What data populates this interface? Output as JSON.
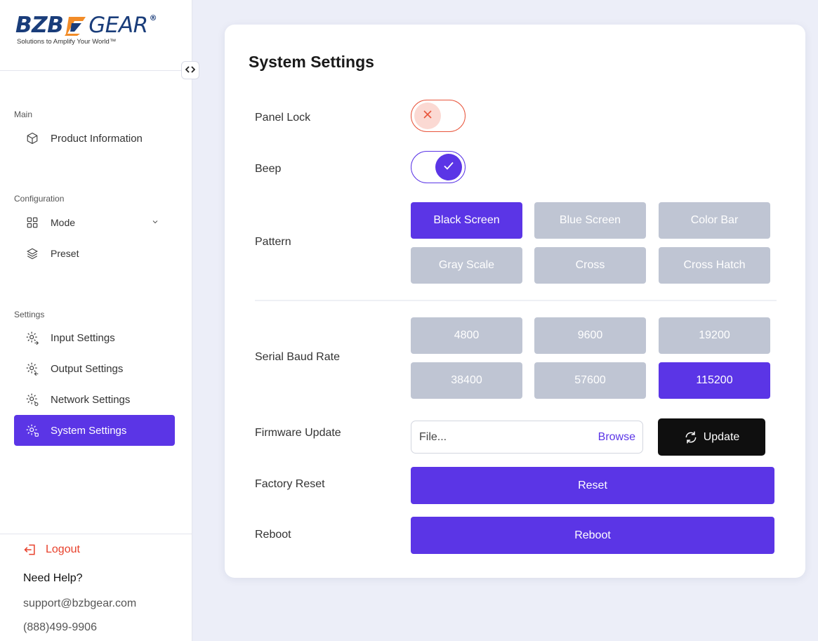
{
  "brand": {
    "name_left": "BZB",
    "name_right": "GEAR",
    "registered": "®",
    "tagline": "Solutions to Amplify Your World™",
    "colors": {
      "navy": "#1a3d7a",
      "orange": "#f28c28"
    }
  },
  "sidebar": {
    "collapse_icon": "chevrons-left-right-icon",
    "sections": {
      "main": "Main",
      "configuration": "Configuration",
      "settings": "Settings"
    },
    "items": [
      {
        "label": "Product Information",
        "icon": "cube-icon"
      },
      {
        "label": "Mode",
        "icon": "grid-icon",
        "expandable": true
      },
      {
        "label": "Preset",
        "icon": "layers-icon"
      },
      {
        "label": "Input Settings",
        "icon": "gear-input-icon"
      },
      {
        "label": "Output Settings",
        "icon": "gear-output-icon"
      },
      {
        "label": "Network Settings",
        "icon": "gear-network-icon"
      },
      {
        "label": "System Settings",
        "icon": "gear-system-icon",
        "active": true
      }
    ],
    "logout": "Logout",
    "help": {
      "title": "Need Help?",
      "email": "support@bzbgear.com",
      "phone": "(888)499-9906"
    }
  },
  "main": {
    "title": "System Settings",
    "panel_lock": {
      "label": "Panel Lock",
      "state": "off"
    },
    "beep": {
      "label": "Beep",
      "state": "on"
    },
    "pattern": {
      "label": "Pattern",
      "options": [
        "Black Screen",
        "Blue Screen",
        "Color Bar",
        "Gray Scale",
        "Cross",
        "Cross Hatch"
      ],
      "selected": "Black Screen"
    },
    "baud_rate": {
      "label": "Serial Baud Rate",
      "options": [
        "4800",
        "9600",
        "19200",
        "38400",
        "57600",
        "115200"
      ],
      "selected": "115200"
    },
    "firmware": {
      "label": "Firmware Update",
      "placeholder": "File...",
      "browse": "Browse",
      "update": "Update"
    },
    "factory_reset": {
      "label": "Factory Reset",
      "button": "Reset"
    },
    "reboot": {
      "label": "Reboot",
      "button": "Reboot"
    }
  },
  "colors": {
    "accent": "#5b35e6",
    "inactive_option": "#bfc5d3",
    "danger": "#e8553c",
    "logout": "#e8412c"
  }
}
